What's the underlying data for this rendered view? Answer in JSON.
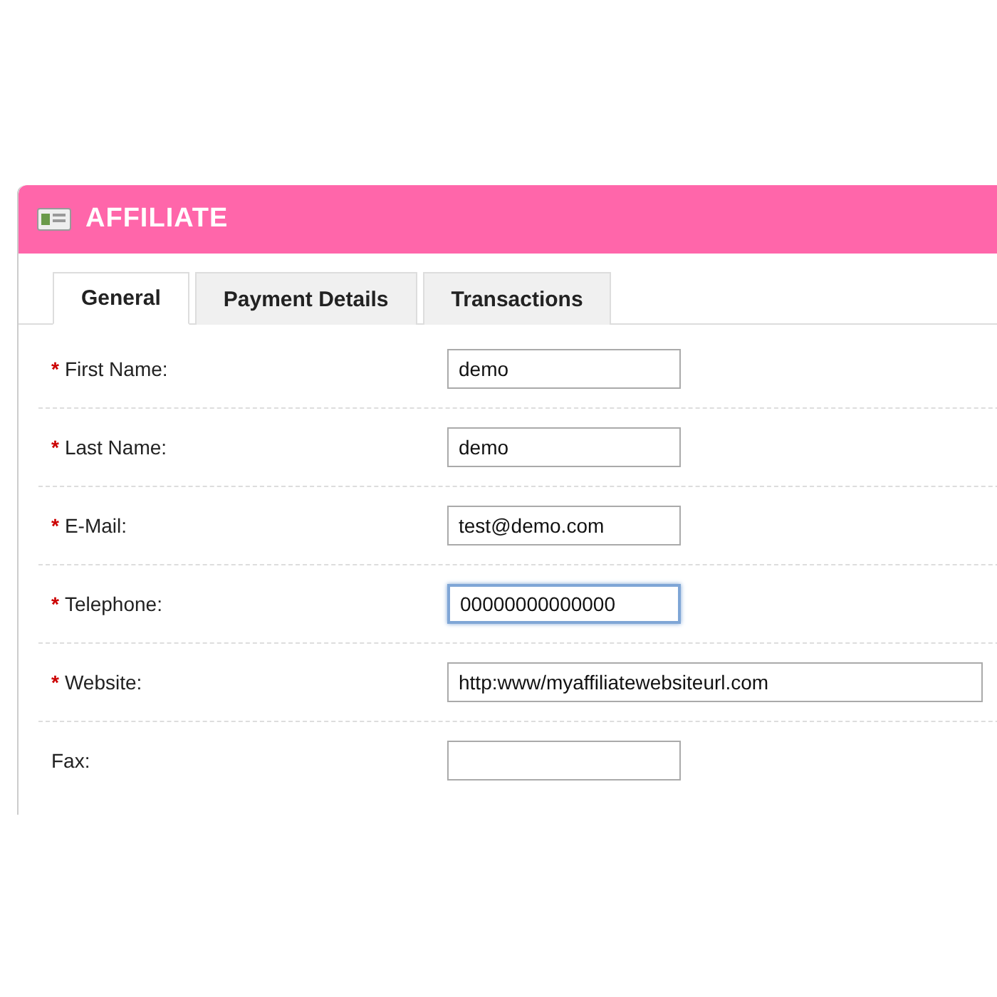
{
  "panel": {
    "title": "AFFILIATE"
  },
  "tabs": [
    {
      "label": "General",
      "selected": true
    },
    {
      "label": "Payment Details",
      "selected": false
    },
    {
      "label": "Transactions",
      "selected": false
    }
  ],
  "fields": [
    {
      "label": "First Name:",
      "required_mark": "*",
      "value": "demo",
      "kind": "short",
      "focused": false
    },
    {
      "label": "Last Name:",
      "required_mark": "*",
      "value": "demo",
      "kind": "short",
      "focused": false
    },
    {
      "label": "E-Mail:",
      "required_mark": "*",
      "value": "test@demo.com",
      "kind": "short",
      "focused": false
    },
    {
      "label": "Telephone:",
      "required_mark": "*",
      "value": "00000000000000",
      "kind": "short",
      "focused": true
    },
    {
      "label": "Website:",
      "required_mark": "*",
      "value": "http:www/myaffiliatewebsiteurl.com",
      "kind": "wide",
      "focused": false
    },
    {
      "label": "Fax:",
      "kind": "short",
      "focused": false
    }
  ]
}
